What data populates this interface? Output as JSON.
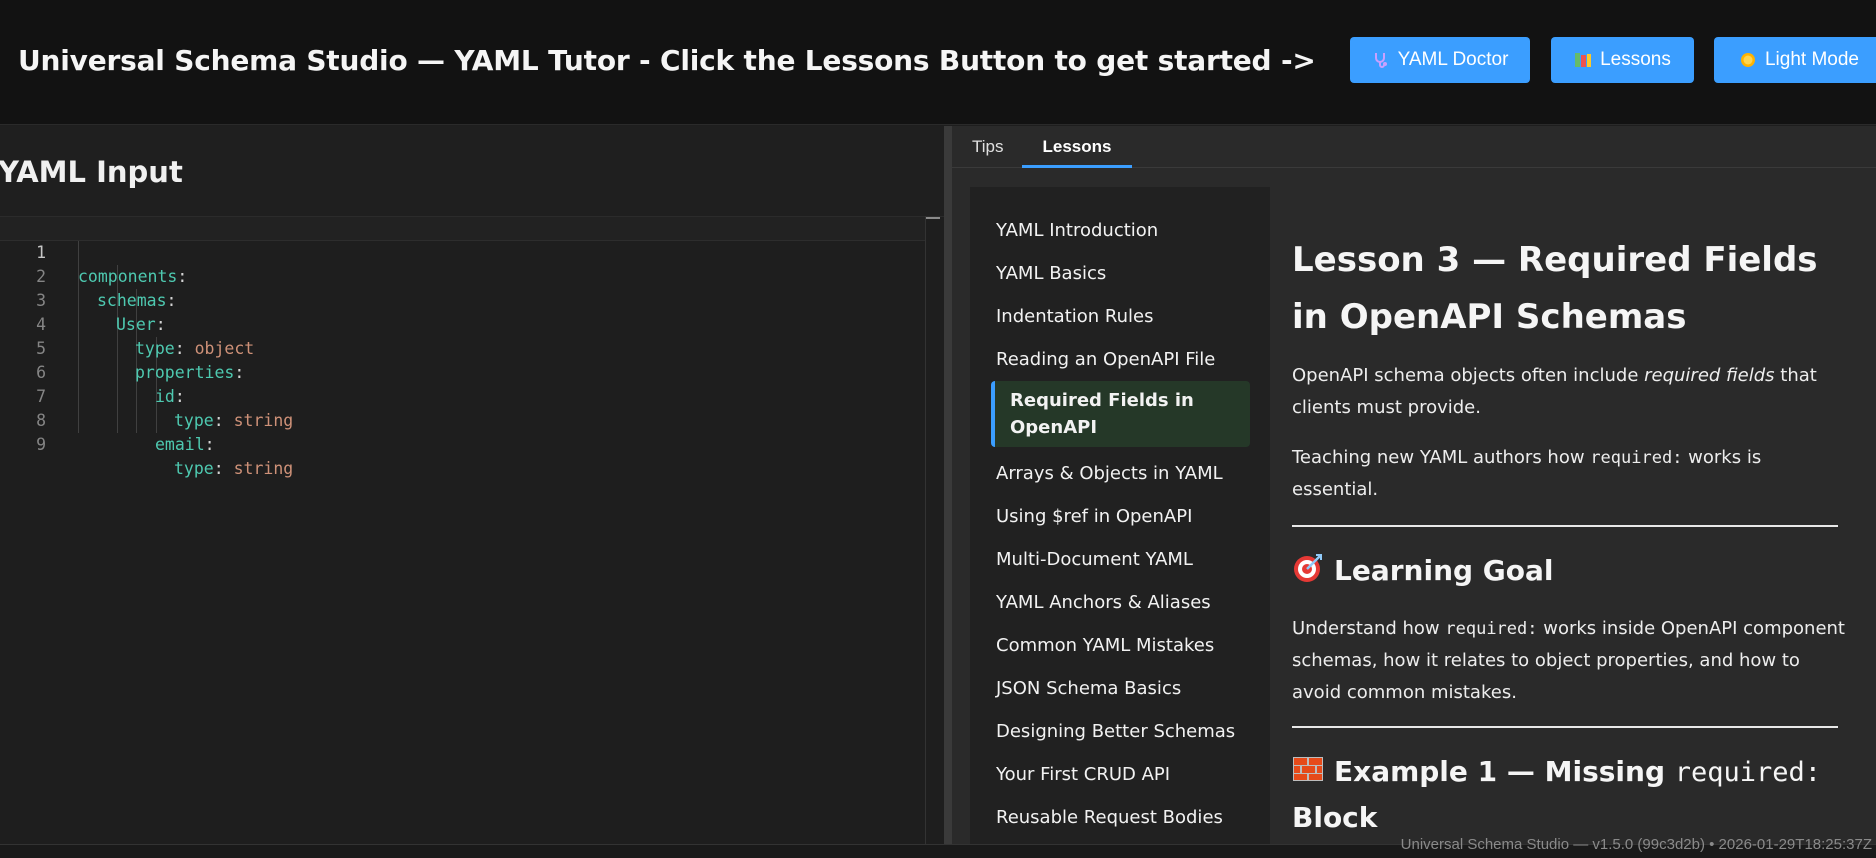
{
  "header": {
    "title": "Universal Schema Studio — YAML Tutor - Click the Lessons Button to get started ->",
    "buttons": {
      "doctor": "YAML Doctor",
      "lessons": "Lessons",
      "light_mode": "Light Mode"
    }
  },
  "editor": {
    "title": "YAML Input",
    "line_numbers": [
      "1",
      "2",
      "3",
      "4",
      "5",
      "6",
      "7",
      "8",
      "9"
    ],
    "lines": [
      {
        "key": "components",
        "sep": ":",
        "value": ""
      },
      {
        "key": "schemas",
        "sep": ":",
        "value": ""
      },
      {
        "key": "User",
        "sep": ":",
        "value": ""
      },
      {
        "key": "type",
        "sep": ": ",
        "value": "object"
      },
      {
        "key": "properties",
        "sep": ":",
        "value": ""
      },
      {
        "key": "id",
        "sep": ":",
        "value": ""
      },
      {
        "key": "type",
        "sep": ": ",
        "value": "string"
      },
      {
        "key": "email",
        "sep": ":",
        "value": ""
      },
      {
        "key": "type",
        "sep": ": ",
        "value": "string"
      }
    ]
  },
  "tabs": {
    "tips": "Tips",
    "lessons": "Lessons"
  },
  "lesson_nav": [
    "YAML Introduction",
    "YAML Basics",
    "Indentation Rules",
    "Reading an OpenAPI File",
    "Required Fields in OpenAPI",
    "Arrays & Objects in YAML",
    "Using $ref in OpenAPI",
    "Multi-Document YAML",
    "YAML Anchors & Aliases",
    "Common YAML Mistakes",
    "JSON Schema Basics",
    "Designing Better Schemas",
    "Your First CRUD API",
    "Reusable Request Bodies"
  ],
  "lesson": {
    "title": "Lesson 3 — Required Fields in OpenAPI Schemas",
    "intro_before": "OpenAPI schema objects often include ",
    "intro_em": "required fields",
    "intro_after": " that clients must provide.",
    "teach_before": "Teaching new YAML authors how ",
    "teach_code": "required:",
    "teach_after": " works is essential.",
    "goal_heading": "Learning Goal",
    "goal_before": "Understand how ",
    "goal_code": "required:",
    "goal_after": " works inside OpenAPI component schemas, how it relates to object properties, and how to avoid common mistakes.",
    "example_heading_before": "Example 1 — Missing ",
    "example_heading_code": "required:",
    "example_heading_after": " Block"
  },
  "footer": {
    "version": "Universal Schema Studio — v1.5.0 (99c3d2b) • 2026-01-29T18:25:37Z"
  },
  "colors": {
    "accent": "#3b9eff",
    "yaml_key": "#4ec9b0",
    "yaml_string": "#ce9178",
    "active_nav_bg": "#253828"
  }
}
